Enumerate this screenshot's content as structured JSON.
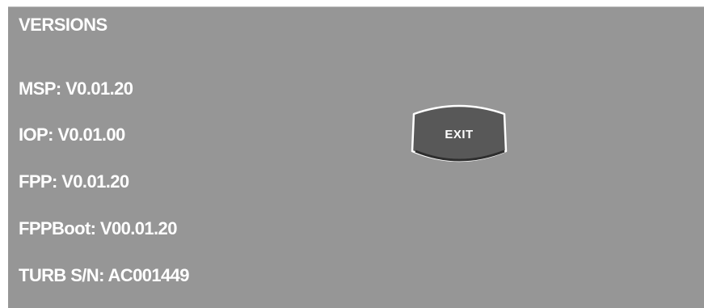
{
  "screen": {
    "title": "VERSIONS",
    "lines": [
      "MSP: V0.01.20",
      "IOP: V0.01.00",
      "FPP: V0.01.20",
      "FPPBoot: V00.01.20",
      "TURB S/N: AC001449"
    ],
    "exit_label": "EXIT"
  },
  "colors": {
    "background": "#969696",
    "text": "#ffffff",
    "button_fill": "#5a5a5a",
    "button_border": "#ffffff"
  }
}
